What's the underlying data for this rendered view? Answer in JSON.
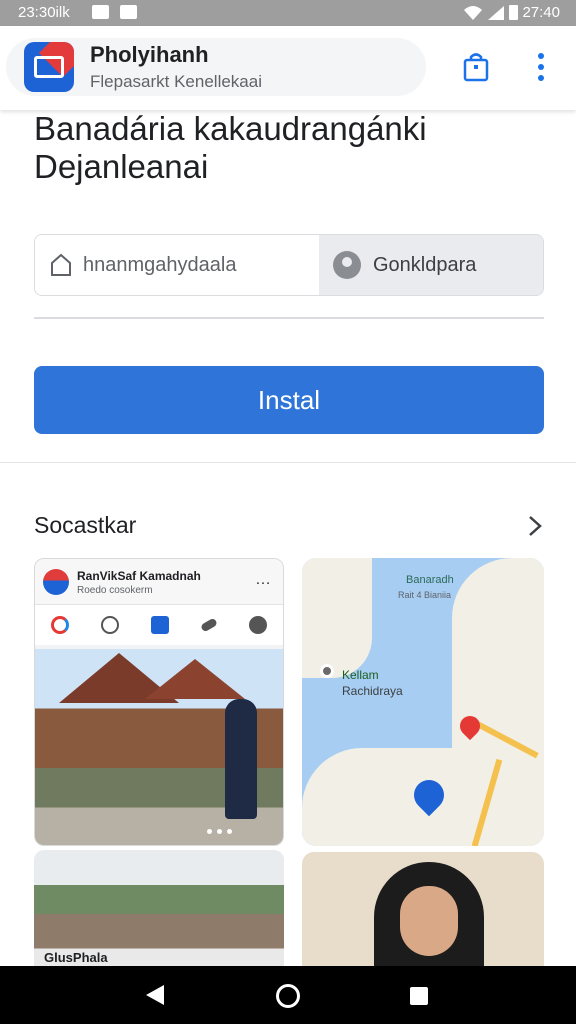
{
  "status_bar": {
    "time_left": "23:30ilk",
    "time_right": "27:40"
  },
  "header": {
    "app_name": "Pholyihanh",
    "app_subtitle": "Flepasarkt Kenellekaai"
  },
  "title": {
    "line1": "Banadária kakaudrangánki",
    "line2": "Dejanleanai"
  },
  "input": {
    "value": "hnanmgahydaala",
    "right_label": "Gonkldpara"
  },
  "install_label": "Instal",
  "section_title": "Socastkar",
  "card1": {
    "title": "RanVikSaf Kamadnah",
    "subtitle": "Roedo cosokerm",
    "dots": "…"
  },
  "map": {
    "top_label": "Banaradh",
    "top_sub": "Rait 4 Bianiia",
    "place1": "Kellam",
    "place2": "Rachidraya"
  },
  "card3_caption": "GlusPhala",
  "colors": {
    "accent": "#2e74d9",
    "status_bar": "#9e9e9e"
  }
}
